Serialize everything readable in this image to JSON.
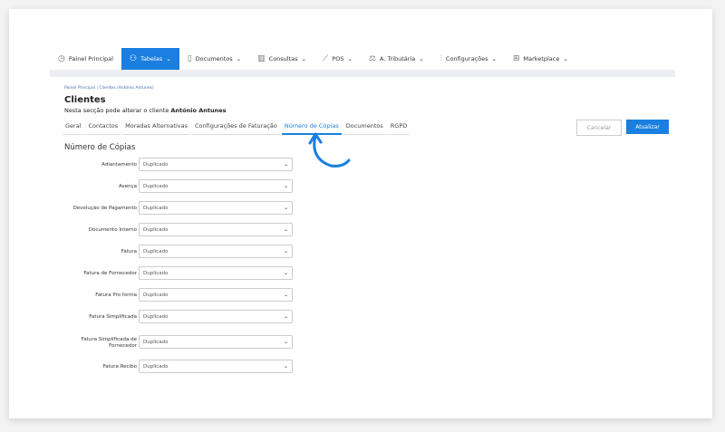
{
  "nav": [
    {
      "label": "Painel Principal",
      "icon": "clock-icon"
    },
    {
      "label": "Tabelas",
      "icon": "users-icon",
      "active": true
    },
    {
      "label": "Documentos",
      "icon": "document-icon"
    },
    {
      "label": "Consultas",
      "icon": "chart-icon"
    },
    {
      "label": "POS",
      "icon": "pos-icon"
    },
    {
      "label": "A. Tributária",
      "icon": "tax-icon"
    },
    {
      "label": "Configurações",
      "icon": "sliders-icon"
    },
    {
      "label": "Marketplace",
      "icon": "grid-icon"
    }
  ],
  "breadcrumb": {
    "home": "Painel Principal",
    "sep": "|",
    "current": "Clientes (António Antunes)"
  },
  "title": "Clientes",
  "subtitle": {
    "text": "Nesta secção pode alterar o cliente ",
    "name": "António Antunes"
  },
  "tabs": [
    "Geral",
    "Contactos",
    "Moradas Alternativas",
    "Configurações de Faturação",
    "Número de Cópias",
    "Documentos",
    "RGPD"
  ],
  "buttons": {
    "cancel": "Cancelar",
    "update": "Atualizar"
  },
  "section_title": "Número de Cópias",
  "fields": [
    {
      "label": "Adiantamento",
      "value": "Duplicado"
    },
    {
      "label": "Avença",
      "value": "Duplicado"
    },
    {
      "label": "Devolução de Pagamento",
      "value": "Duplicado"
    },
    {
      "label": "Documento Interno",
      "value": "Duplicado"
    },
    {
      "label": "Fatura",
      "value": "Duplicado"
    },
    {
      "label": "Fatura de Fornecedor",
      "value": "Duplicado"
    },
    {
      "label": "Fatura Pro forma",
      "value": "Duplicado"
    },
    {
      "label": "Fatura Simplificada",
      "value": "Duplicado"
    },
    {
      "label": "Fatura Simplificada de Fornecedor",
      "value": "Duplicado"
    },
    {
      "label": "Fatura Recibo",
      "value": "Duplicado"
    }
  ]
}
